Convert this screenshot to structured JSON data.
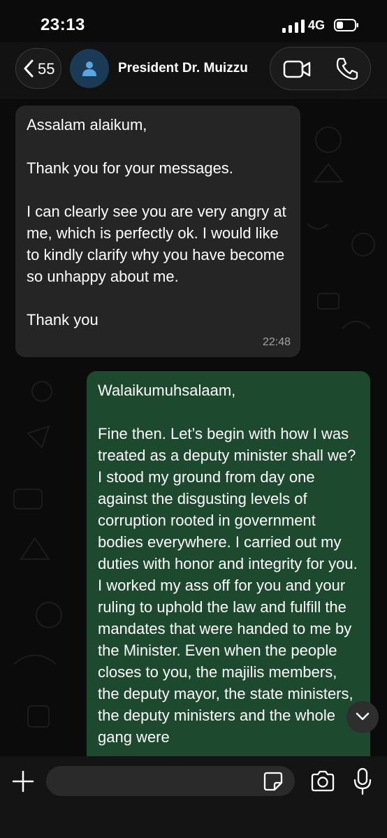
{
  "status_bar": {
    "time": "23:13",
    "network": "4G",
    "icons": [
      "signal-icon",
      "battery-icon"
    ]
  },
  "header": {
    "back_count": "55",
    "contact_name": "President Dr. Muizzu",
    "icons": [
      "back-chevron-icon",
      "person-icon",
      "video-call-icon",
      "phone-icon"
    ]
  },
  "messages": [
    {
      "direction": "incoming",
      "text": "Assalam alaikum,\n\nThank you for your messages.\n\nI can clearly see you are very angry at me, which is perfectly ok. I would like to kindly clarify why you have become so unhappy about me.\n\nThank you",
      "time": "22:48"
    },
    {
      "direction": "outgoing",
      "text": "Walaikumuhsalaam,\n\nFine then. Let’s begin with how I was treated as a deputy minister shall we? I stood my ground from day one against the disgusting levels of corruption rooted in government bodies everywhere. I carried out my duties with honor and integrity for you. I worked my ass off for you and your ruling to uphold the law and fulfill the mandates that were handed to me by the Minister. Even when the people closes to you, the majilis members, the deputy mayor, the state ministers, the deputy ministers and the whole gang were"
    }
  ],
  "composer": {
    "input_value": "",
    "icons": [
      "plus-icon",
      "sticker-icon",
      "camera-icon",
      "microphone-icon",
      "chevron-down-icon"
    ]
  },
  "colors": {
    "background": "#0b0b0b",
    "incoming_bubble": "#252525",
    "outgoing_bubble": "#1d4a2f",
    "timestamp": "#a3a3a3",
    "avatar_bg": "#1b3a55",
    "avatar_icon": "#5aa7e0"
  }
}
